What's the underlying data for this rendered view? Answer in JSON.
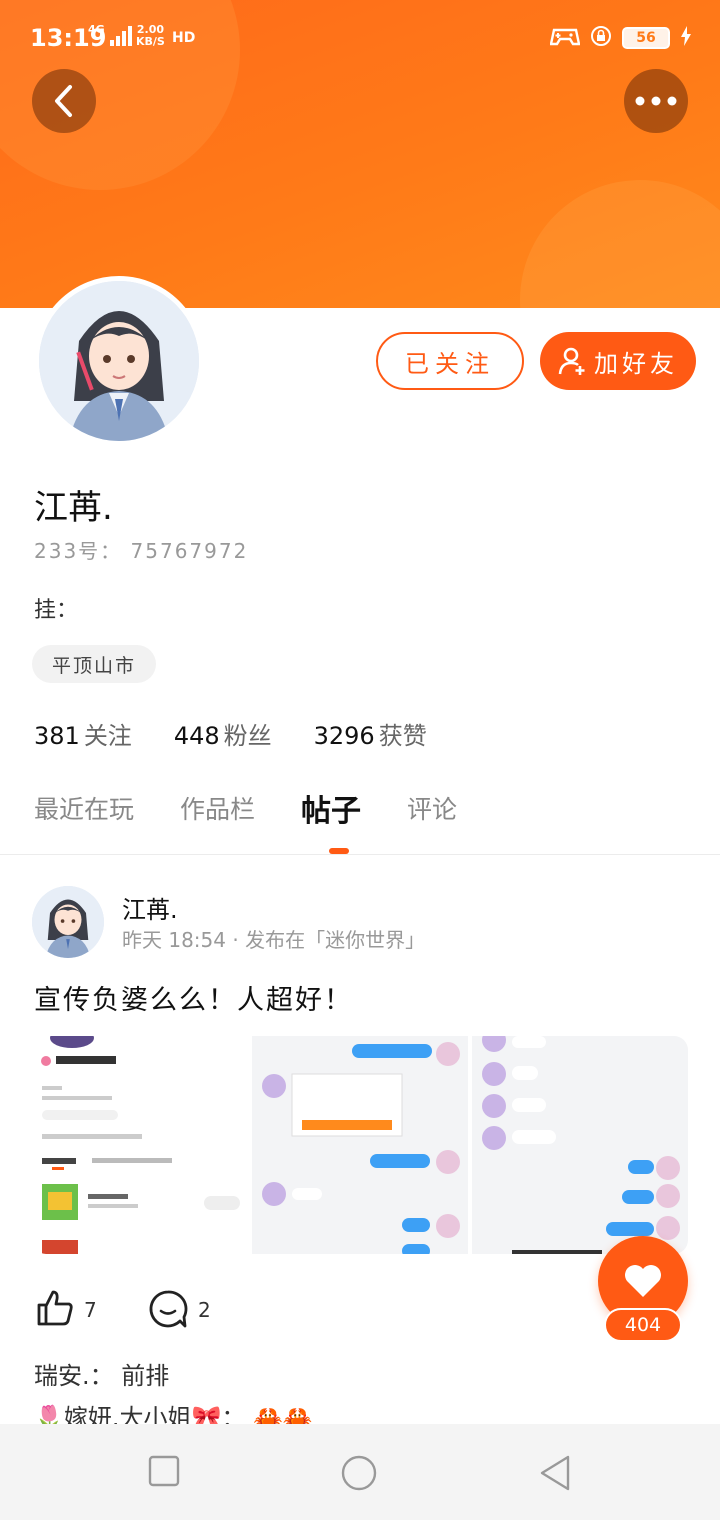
{
  "status_bar": {
    "time": "13:19",
    "network": "4G",
    "speed_value": "2.00",
    "speed_unit": "KB/S",
    "hd": "HD",
    "battery": "56"
  },
  "header": {
    "back_icon": "chevron-left-icon",
    "more_icon": "more-dots-icon",
    "color": "#ff7a18"
  },
  "profile": {
    "name": "江苒.",
    "id_line": "233号： 75767972",
    "signature": "挂：",
    "location": "平顶山市",
    "follow_label": "已关注",
    "add_friend_label": "加好友",
    "stats": [
      {
        "num": "381",
        "label": "关注"
      },
      {
        "num": "448",
        "label": "粉丝"
      },
      {
        "num": "3296",
        "label": "获赞"
      }
    ]
  },
  "tabs": [
    {
      "label": "最近在玩",
      "active": false
    },
    {
      "label": "作品栏",
      "active": false
    },
    {
      "label": "帖子",
      "active": true
    },
    {
      "label": "评论",
      "active": false
    }
  ],
  "post": {
    "author": "江苒.",
    "meta": "昨天 18:54 · 发布在「迷你世界」",
    "text": "宣传负婆么么！人超好！",
    "like_count": "7",
    "comment_count": "2"
  },
  "fab": {
    "icon": "heart-icon",
    "count": "404"
  },
  "comments": [
    {
      "text": "瑞安.： 前排"
    },
    {
      "text": "🌷嫁妍.大小姐🎀： 🦀🦀"
    }
  ],
  "colors": {
    "accent": "#ff5a14",
    "header": "#ff7a18"
  }
}
